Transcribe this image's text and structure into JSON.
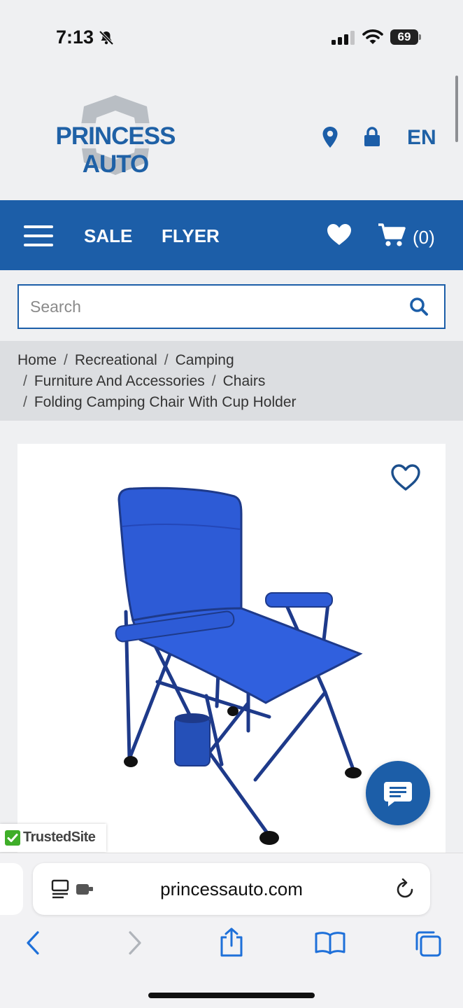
{
  "status_bar": {
    "time": "7:13",
    "battery": "69"
  },
  "header": {
    "logo_text": "PRINCESS AUTO",
    "language": "EN"
  },
  "nav": {
    "sale": "SALE",
    "flyer": "FLYER",
    "cart_count": "(0)"
  },
  "search": {
    "placeholder": "Search"
  },
  "breadcrumb": {
    "items": [
      "Home",
      "Recreational",
      "Camping",
      "Furniture And Accessories",
      "Chairs",
      "Folding Camping Chair With Cup Holder"
    ],
    "separator": "/"
  },
  "badge": {
    "trusted_site": "TrustedSite"
  },
  "browser": {
    "url": "princessauto.com"
  },
  "colors": {
    "brand_blue": "#1c5ea8",
    "logo_blue": "#1f61a6",
    "chair_blue": "#2d5bd6",
    "trusted_green": "#3fae29"
  },
  "icons": [
    "bell-off-icon",
    "signal-icon",
    "wifi-icon",
    "battery-icon",
    "location-pin-icon",
    "lock-icon",
    "hamburger-menu-icon",
    "heart-icon",
    "cart-icon",
    "search-icon",
    "wishlist-heart-icon",
    "chat-icon",
    "trusted-check-icon",
    "reader-icon",
    "reload-icon",
    "back-icon",
    "forward-icon",
    "share-icon",
    "bookmarks-icon",
    "tabs-icon"
  ]
}
